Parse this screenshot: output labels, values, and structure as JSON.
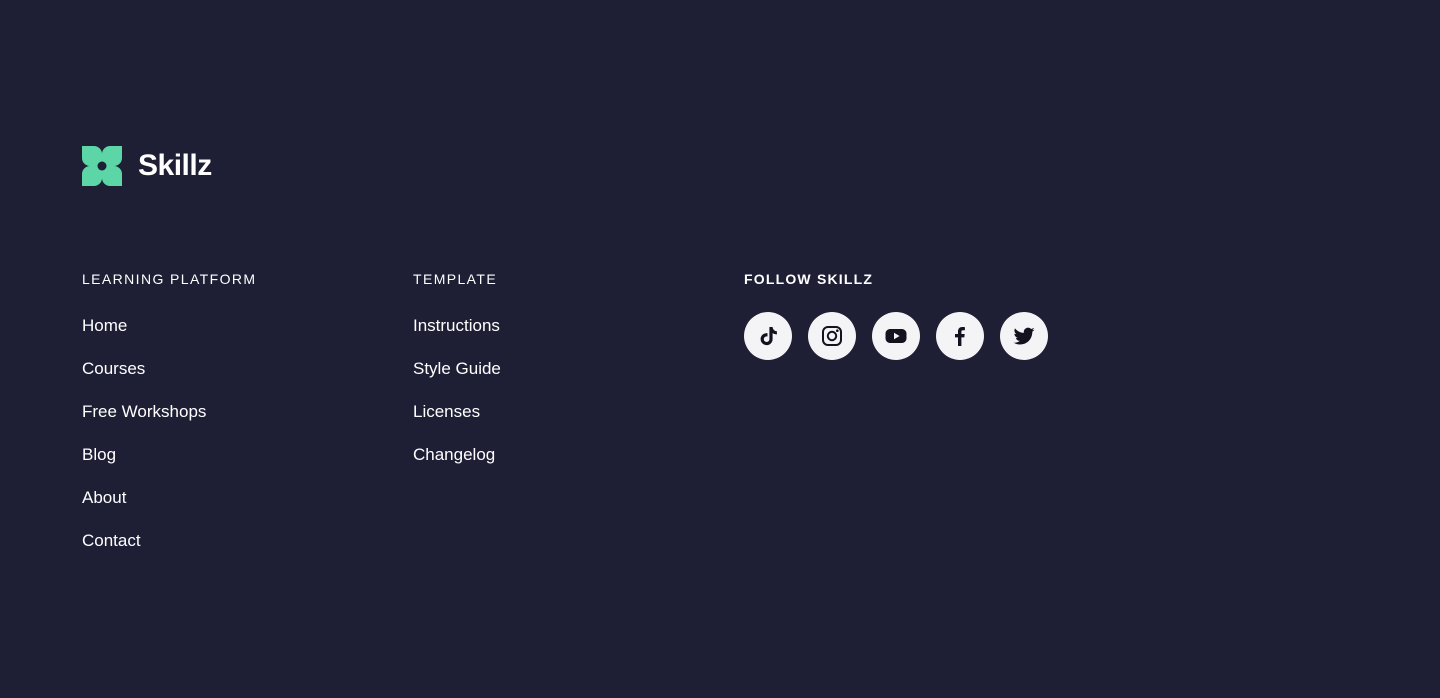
{
  "brand": {
    "name": "Skillz",
    "logo_icon": "four-petal-logo-icon",
    "accent_color": "#5cd6a6"
  },
  "colors": {
    "background": "#1e1e34",
    "text": "#ffffff",
    "social_bg": "#f4f4f6",
    "social_icon": "#13131f"
  },
  "columns": {
    "learning": {
      "heading": "LEARNING PLATFORM",
      "links": [
        "Home",
        "Courses",
        "Free Workshops",
        "Blog",
        "About",
        "Contact"
      ]
    },
    "template": {
      "heading": "TEMPLATE",
      "links": [
        "Instructions",
        "Style Guide",
        "Licenses",
        "Changelog"
      ]
    },
    "follow": {
      "heading": "FOLLOW SKILLZ",
      "icons": [
        "tiktok-icon",
        "instagram-icon",
        "youtube-icon",
        "facebook-icon",
        "twitter-icon"
      ]
    }
  }
}
